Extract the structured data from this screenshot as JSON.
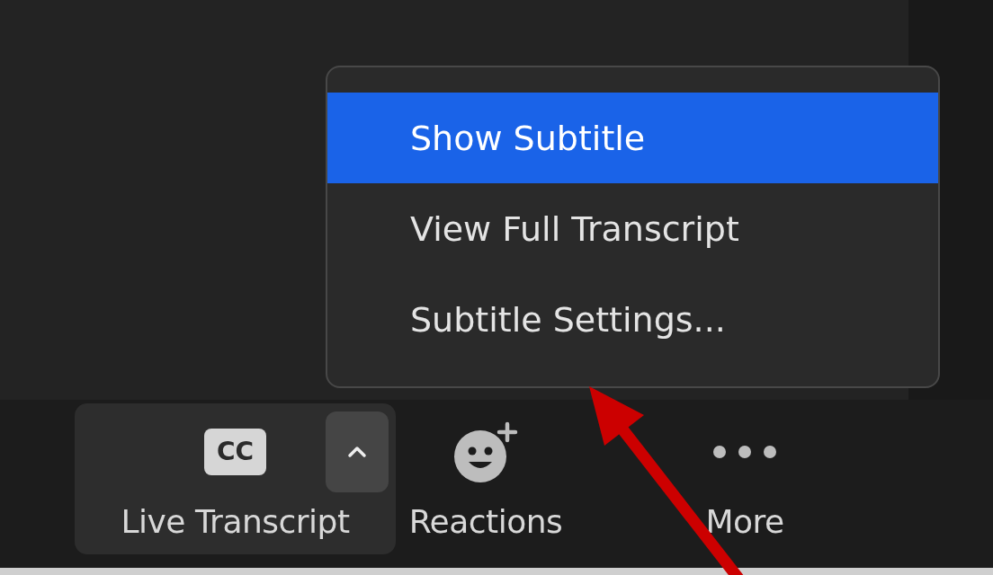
{
  "popup_menu": {
    "items": [
      {
        "label": "Show Subtitle",
        "selected": true
      },
      {
        "label": "View Full Transcript",
        "selected": false
      },
      {
        "label": "Subtitle Settings...",
        "selected": false
      }
    ]
  },
  "toolbar": {
    "buttons": [
      {
        "kind": "transcript",
        "badge": "CC",
        "label": "Live Transcript",
        "active": true
      },
      {
        "kind": "reactions",
        "label": "Reactions",
        "active": false
      },
      {
        "kind": "more",
        "label": "More",
        "active": false
      }
    ]
  },
  "annotation": {
    "kind": "arrow"
  }
}
